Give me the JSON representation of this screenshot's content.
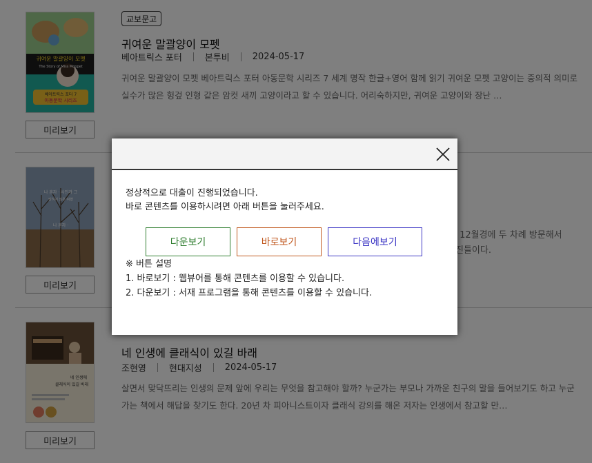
{
  "books": [
    {
      "badge": "교보문고",
      "title": "귀여운 말괄양이 모펫",
      "author": "베아트릭스 포터",
      "publisher": "본투비",
      "date": "2024-05-17",
      "description": "귀여운 말괄양이 모펫 베아트릭스 포터 아동문학 시리즈 7 세계 명작 한글+영어 함께 읽기 귀여운 모펫 고양이는 중의적 의미로 실수가 많은 헝겊 인형 같은 암컷 새끼 고양이라고 할 수 있습니다. 어리숙하지만, 귀여운 고양이와 장난 …",
      "cover_text_1": "귀여운 말괄양이 모펫",
      "cover_text_2": "The Story of Miss Moppet",
      "cover_text_3": "베아트릭스 포터 7",
      "cover_text_4": "아동문학 시리즈",
      "preview_label": "미리보기"
    },
    {
      "description_partial_1": "가 12월경에 두 차례 방문해서",
      "description_partial_2": "진들이다.",
      "cover_text_1": "나 혼자 · 사진과 그",
      "cover_text_2": "밝히지 않은 여행",
      "cover_text_3": "나 혼자 ·",
      "preview_label": "미리보기"
    },
    {
      "title": "네 인생에 클래식이 있길 바래",
      "author": "조현영",
      "publisher": "현대지성",
      "date": "2024-05-17",
      "description": "살면서 맞닥뜨리는 인생의 문제 앞에 우리는 무엇을 참고해야 할까? 누군가는 부모나 가까운 친구의 말을 들어보기도 하고 누군가는 책에서 해답을 찾기도 한다. 20년 차 피아니스트이자 클래식 강의를 해온 저자는 인생에서 참고할 만…",
      "cover_text_1": "네 인생에",
      "cover_text_2": "클래식이 있길 바래",
      "preview_label": "미리보기"
    }
  ],
  "modal": {
    "message_line1": "정상적으로 대출이 진행되었습니다.",
    "message_line2": "바로 콘텐츠를 이용하시려면 아래 버튼을 눌러주세요.",
    "buttons": {
      "download": "다운보기",
      "view_now": "바로보기",
      "view_later": "다음에보기"
    },
    "help_title": "※ 버튼 설명",
    "help_line1": "1. 바로보기 : 웹뷰어를 통해 콘텐츠를 이용할 수 있습니다.",
    "help_line2": "2. 다운보기 : 서재 프로그램을 통해 콘텐츠를 이용할 수 있습니다."
  },
  "colors": {
    "download": "#2e7d2e",
    "view_now": "#c0561c",
    "view_later": "#3b35c4"
  }
}
